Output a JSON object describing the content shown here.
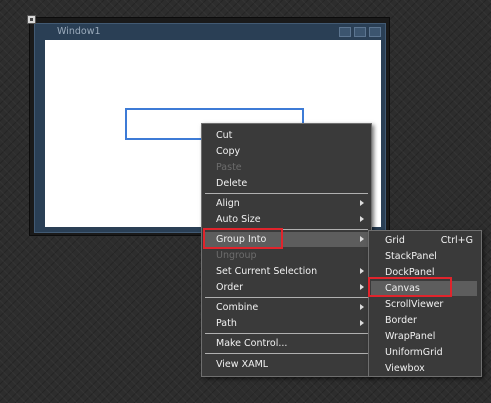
{
  "window": {
    "title": "Window1"
  },
  "context_menu": {
    "cut": "Cut",
    "copy": "Copy",
    "paste": "Paste",
    "delete": "Delete",
    "align": "Align",
    "auto_size": "Auto Size",
    "group_into": "Group Into",
    "ungroup": "Ungroup",
    "set_current_selection": "Set Current Selection",
    "order": "Order",
    "combine": "Combine",
    "path": "Path",
    "make_control": "Make Control...",
    "view_xaml": "View XAML"
  },
  "group_into_submenu": {
    "grid": "Grid",
    "grid_shortcut": "Ctrl+G",
    "stackpanel": "StackPanel",
    "dockpanel": "DockPanel",
    "canvas": "Canvas",
    "scrollviewer": "ScrollViewer",
    "border": "Border",
    "wrappanel": "WrapPanel",
    "uniformgrid": "UniformGrid",
    "viewbox": "Viewbox"
  },
  "colors": {
    "menu_bg": "#3a3a3a",
    "highlight_box": "#e0242c",
    "selection": "#3d7bd6"
  }
}
